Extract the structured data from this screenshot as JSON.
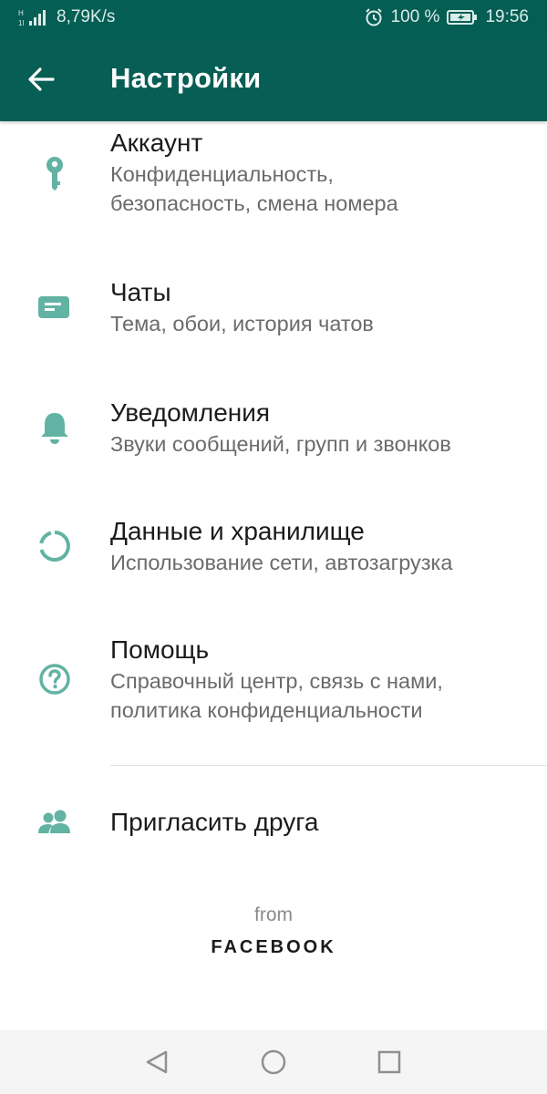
{
  "status_bar": {
    "network_speed": "8,79K/s",
    "battery_percent": "100 %",
    "time": "19:56",
    "icons": [
      "signal-icon",
      "alarm-icon",
      "battery-charging-icon"
    ]
  },
  "app_bar": {
    "title": "Настройки",
    "back_icon": "arrow-left-icon"
  },
  "settings": [
    {
      "icon": "key-icon",
      "title": "Аккаунт",
      "subtitle": [
        "Конфиденциальность,",
        "безопасность, смена номера"
      ]
    },
    {
      "icon": "chat-icon",
      "title": "Чаты",
      "subtitle": [
        "Тема, обои, история чатов"
      ]
    },
    {
      "icon": "bell-icon",
      "title": "Уведомления",
      "subtitle": [
        "Звуки сообщений, групп и звонков"
      ]
    },
    {
      "icon": "data-usage-icon",
      "title": "Данные и хранилище",
      "subtitle": [
        "Использование сети, автозагрузка"
      ]
    },
    {
      "icon": "help-icon",
      "title": "Помощь",
      "subtitle": [
        "Справочный центр, связь с нами,",
        "политика конфиденциальности"
      ]
    }
  ],
  "invite": {
    "icon": "people-icon",
    "title": "Пригласить друга"
  },
  "footer": {
    "from": "from",
    "brand": "FACEBOOK"
  },
  "colors": {
    "header": "#075e54",
    "status_bar": "#055e54",
    "icon_accent": "#62b3a3"
  },
  "nav_bar": {
    "icons": [
      "back-triangle-icon",
      "home-circle-icon",
      "recents-square-icon"
    ]
  }
}
